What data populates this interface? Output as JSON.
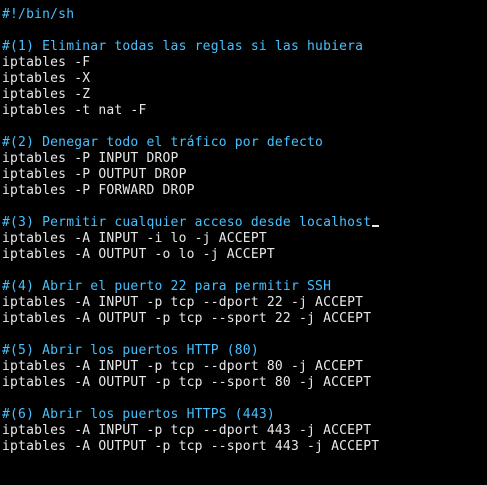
{
  "script": {
    "shebang": "#!/bin/sh",
    "sections": [
      {
        "comment": "#(1) Eliminar todas las reglas si las hubiera",
        "commands": [
          "iptables -F",
          "iptables -X",
          "iptables -Z",
          "iptables -t nat -F"
        ]
      },
      {
        "comment": "#(2) Denegar todo el tráfico por defecto",
        "commands": [
          "iptables -P INPUT DROP",
          "iptables -P OUTPUT DROP",
          "iptables -P FORWARD DROP"
        ]
      },
      {
        "comment": "#(3) Permitir cualquier acceso desde localhost",
        "commands": [
          "iptables -A INPUT -i lo -j ACCEPT",
          "iptables -A OUTPUT -o lo -j ACCEPT"
        ]
      },
      {
        "comment": "#(4) Abrir el puerto 22 para permitir SSH",
        "commands": [
          "iptables -A INPUT -p tcp --dport 22 -j ACCEPT",
          "iptables -A OUTPUT -p tcp --sport 22 -j ACCEPT"
        ]
      },
      {
        "comment": "#(5) Abrir los puertos HTTP (80)",
        "commands": [
          "iptables -A INPUT -p tcp --dport 80 -j ACCEPT",
          "iptables -A OUTPUT -p tcp --sport 80 -j ACCEPT"
        ]
      },
      {
        "comment": "#(6) Abrir los puertos HTTPS (443)",
        "commands": [
          "iptables -A INPUT -p tcp --dport 443 -j ACCEPT",
          "iptables -A OUTPUT -p tcp --sport 443 -j ACCEPT"
        ]
      }
    ]
  },
  "colors": {
    "background": "#000000",
    "comment": "#46c0ff",
    "command": "#e8e8e8"
  }
}
